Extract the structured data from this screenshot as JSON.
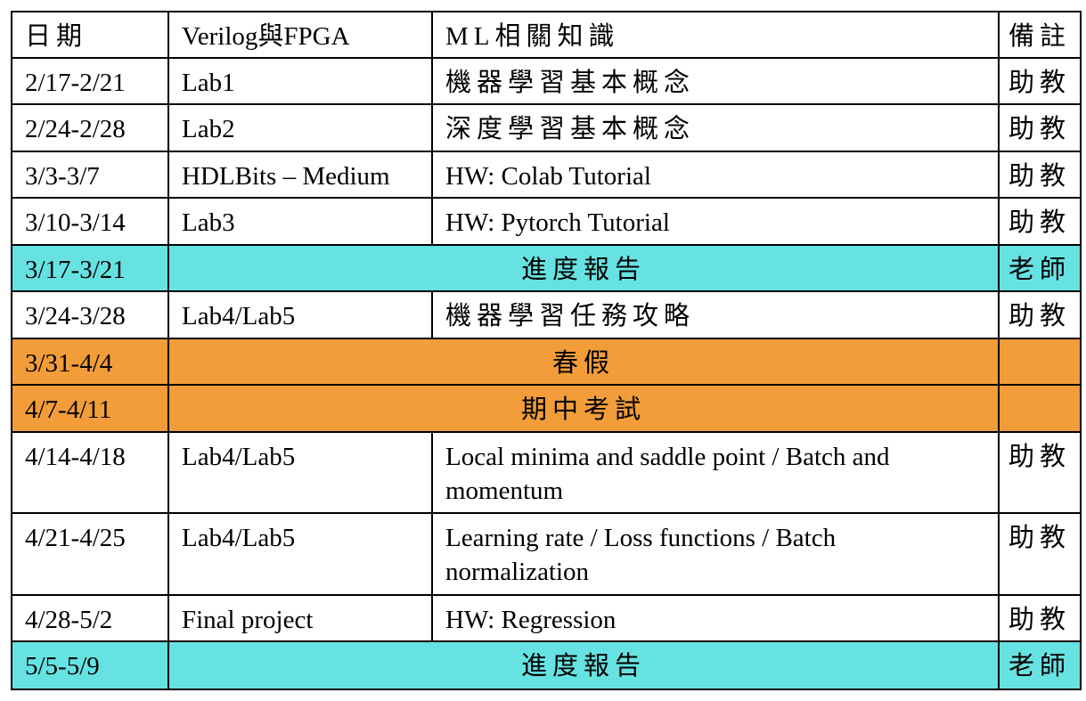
{
  "table": {
    "headers": [
      "日期",
      "Verilog與FPGA",
      "ML相關知識",
      "備註"
    ],
    "rows": [
      {
        "date": "2/17-2/21",
        "verilog": "Lab1",
        "ml": "機器學習基本概念",
        "note": "助教"
      },
      {
        "date": "2/24-2/28",
        "verilog": "Lab2",
        "ml": "深度學習基本概念",
        "note": "助教"
      },
      {
        "date": "3/3-3/7",
        "verilog": "HDLBits – Medium",
        "ml": "HW: Colab Tutorial",
        "note": "助教"
      },
      {
        "date": "3/10-3/14",
        "verilog": "Lab3",
        "ml": "HW: Pytorch Tutorial",
        "note": "助教"
      },
      {
        "date": "3/17-3/21",
        "span": "進度報告",
        "note": "老師",
        "highlight": "#66e2e2"
      },
      {
        "date": "3/24-3/28",
        "verilog": "Lab4/Lab5",
        "ml": "機器學習任務攻略",
        "note": "助教"
      },
      {
        "date": "3/31-4/4",
        "span": "春假",
        "note": "",
        "highlight": "#f29d3a"
      },
      {
        "date": "4/7-4/11",
        "span": "期中考試",
        "note": "",
        "highlight": "#f29d3a"
      },
      {
        "date": "4/14-4/18",
        "verilog": "Lab4/Lab5",
        "ml": "Local minima and saddle point / Batch and momentum",
        "note": "助教"
      },
      {
        "date": "4/21-4/25",
        "verilog": "Lab4/Lab5",
        "ml": "Learning rate / Loss functions / Batch normalization",
        "note": "助教"
      },
      {
        "date": "4/28-5/2",
        "verilog": "Final project",
        "ml": "HW: Regression",
        "note": "助教"
      },
      {
        "date": "5/5-5/9",
        "span": "進度報告",
        "note": "老師",
        "highlight": "#66e2e2"
      }
    ]
  },
  "colors": {
    "border": "#000000",
    "cyan_highlight": "#66e2e2",
    "orange_highlight": "#f29d3a"
  }
}
